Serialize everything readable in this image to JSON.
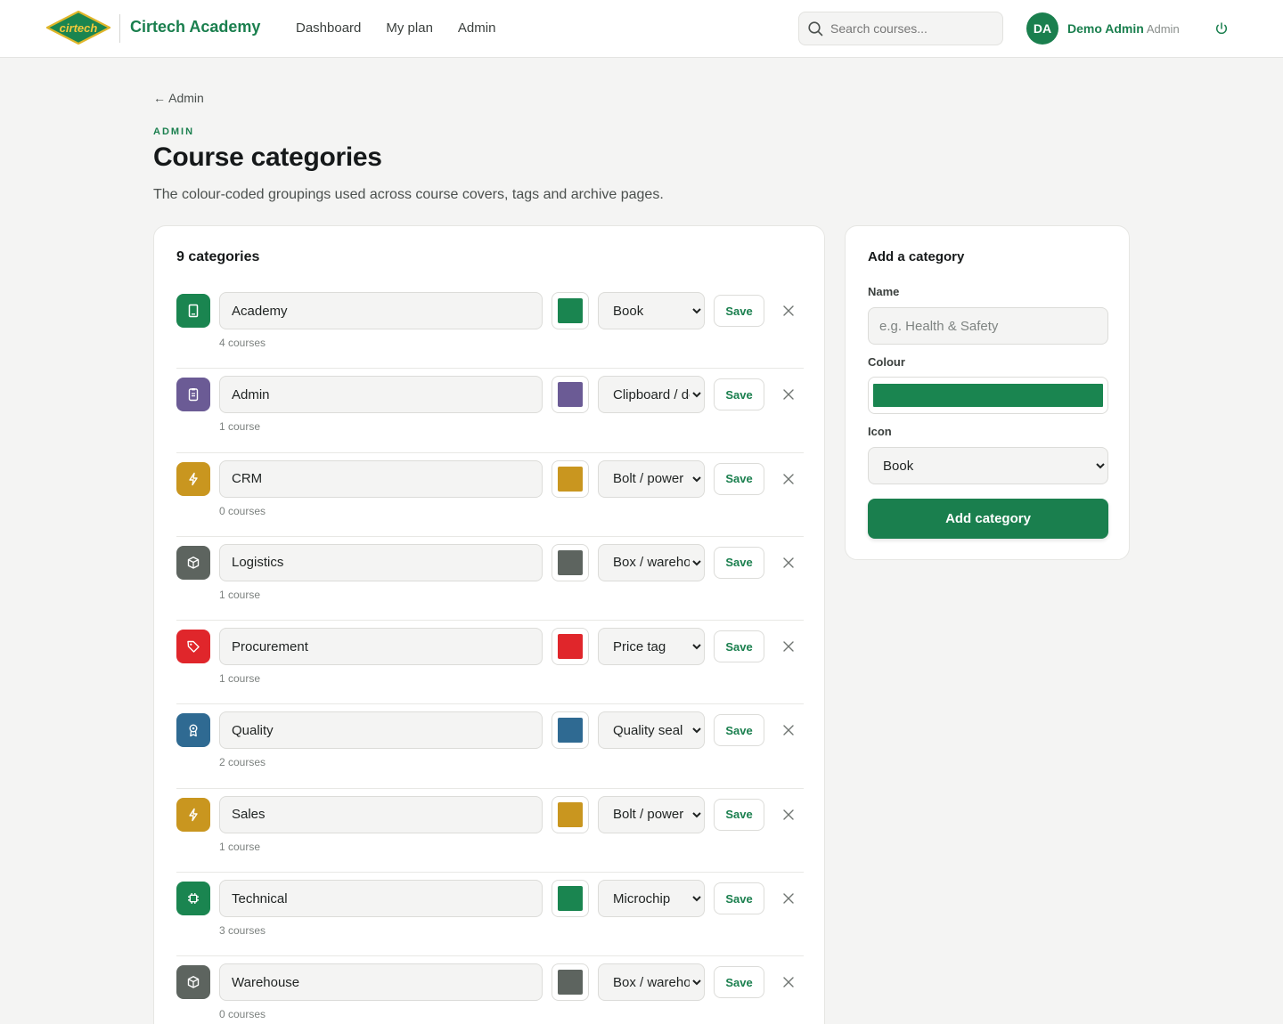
{
  "header": {
    "logo_text": "cirtech",
    "brand": "Cirtech Academy",
    "nav": [
      {
        "label": "Dashboard"
      },
      {
        "label": "My plan"
      },
      {
        "label": "Admin"
      }
    ],
    "search_placeholder": "Search courses...",
    "avatar_initials": "DA",
    "user_name": "Demo Admin",
    "user_role": "Admin"
  },
  "page": {
    "back_label": "← Admin",
    "eyebrow": "ADMIN",
    "title": "Course categories",
    "description": "The colour-coded groupings used across course covers, tags and archive pages."
  },
  "list": {
    "title": "9 categories",
    "save_label": "Save",
    "categories": [
      {
        "name": "Academy",
        "color": "#1a8550",
        "icon": "Book",
        "icon_name": "book-icon",
        "count": "4 courses"
      },
      {
        "name": "Admin",
        "color": "#6b5b95",
        "icon": "Clipboard / docs",
        "icon_name": "clipboard-icon",
        "count": "1 course"
      },
      {
        "name": "CRM",
        "color": "#c9961f",
        "icon": "Bolt / power",
        "icon_name": "bolt-icon",
        "count": "0 courses"
      },
      {
        "name": "Logistics",
        "color": "#5d645f",
        "icon": "Box / warehouse",
        "icon_name": "box-icon",
        "count": "1 course"
      },
      {
        "name": "Procurement",
        "color": "#e0262b",
        "icon": "Price tag",
        "icon_name": "tag-icon",
        "count": "1 course"
      },
      {
        "name": "Quality",
        "color": "#2f6a92",
        "icon": "Quality seal",
        "icon_name": "seal-icon",
        "count": "2 courses"
      },
      {
        "name": "Sales",
        "color": "#c9961f",
        "icon": "Bolt / power",
        "icon_name": "bolt-icon",
        "count": "1 course"
      },
      {
        "name": "Technical",
        "color": "#1a8550",
        "icon": "Microchip",
        "icon_name": "chip-icon",
        "count": "3 courses"
      },
      {
        "name": "Warehouse",
        "color": "#5d645f",
        "icon": "Box / warehouse",
        "icon_name": "box-icon",
        "count": "0 courses"
      }
    ]
  },
  "add": {
    "title": "Add a category",
    "name_label": "Name",
    "name_placeholder": "e.g. Health & Safety",
    "colour_label": "Colour",
    "colour_value": "#1a8550",
    "icon_label": "Icon",
    "icon_value": "Book",
    "button_label": "Add category"
  },
  "theme": {
    "accent": "#1a7f4e"
  }
}
